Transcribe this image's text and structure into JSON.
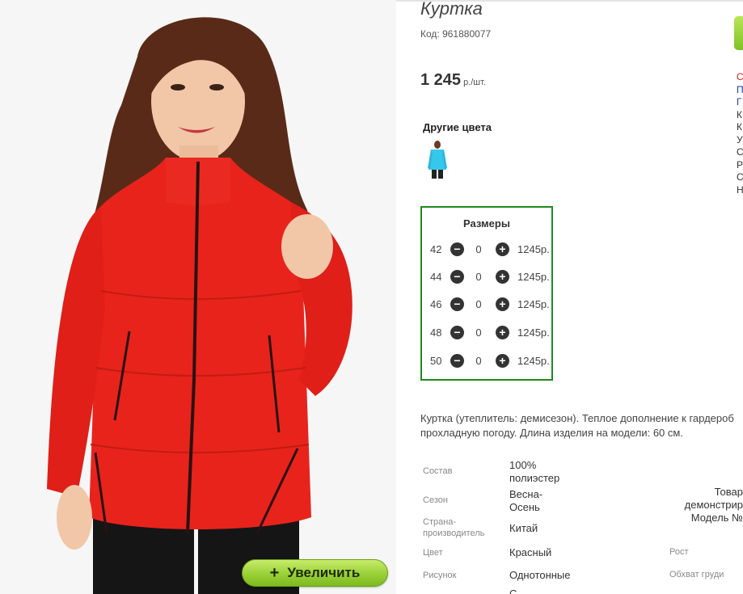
{
  "product": {
    "title": "Куртка",
    "code": "Код: 961880077",
    "price": "1 245",
    "price_unit": "р./шт."
  },
  "zoom_button": {
    "icon": "+",
    "label": "Увеличить"
  },
  "other_colors": {
    "heading": "Другие цвета",
    "thumbs": [
      {
        "color": "#35c8ec"
      }
    ]
  },
  "sizes": {
    "heading": "Размеры",
    "minus": "−",
    "plus": "+",
    "rows": [
      {
        "size": "42",
        "qty": "0",
        "price": "1245р."
      },
      {
        "size": "44",
        "qty": "0",
        "price": "1245р."
      },
      {
        "size": "46",
        "qty": "0",
        "price": "1245р."
      },
      {
        "size": "48",
        "qty": "0",
        "price": "1245р."
      },
      {
        "size": "50",
        "qty": "0",
        "price": "1245р."
      }
    ]
  },
  "description": {
    "line1": "Куртка (утеплитель: демисезон). Теплое дополнение к гардероб",
    "line2": "прохладную погоду. Длина изделия на модели: 60 см."
  },
  "specs": [
    {
      "label": "Состав",
      "value": "100% полиэстер"
    },
    {
      "label": "Сезон",
      "value": "Весна-Осень"
    },
    {
      "label": "Страна-производитель",
      "value": "Китай"
    },
    {
      "label": "Цвет",
      "value": "Красный"
    },
    {
      "label": "Рисунок",
      "value": "Однотонные"
    }
  ],
  "spec_tail": "С",
  "model": {
    "line1": "Товар",
    "line2": "демонстрир",
    "line3": "Модель №",
    "height_label": "Рост",
    "chest_label": "Обхват груди"
  },
  "side_links": [
    "С",
    "П",
    "Г",
    "К",
    "К",
    "У",
    "С",
    "Р",
    "С",
    "Н"
  ],
  "colors": {
    "accent_green": "#1e8a1e",
    "jacket_red": "#e8231c",
    "button_green": "#9dd23a"
  }
}
